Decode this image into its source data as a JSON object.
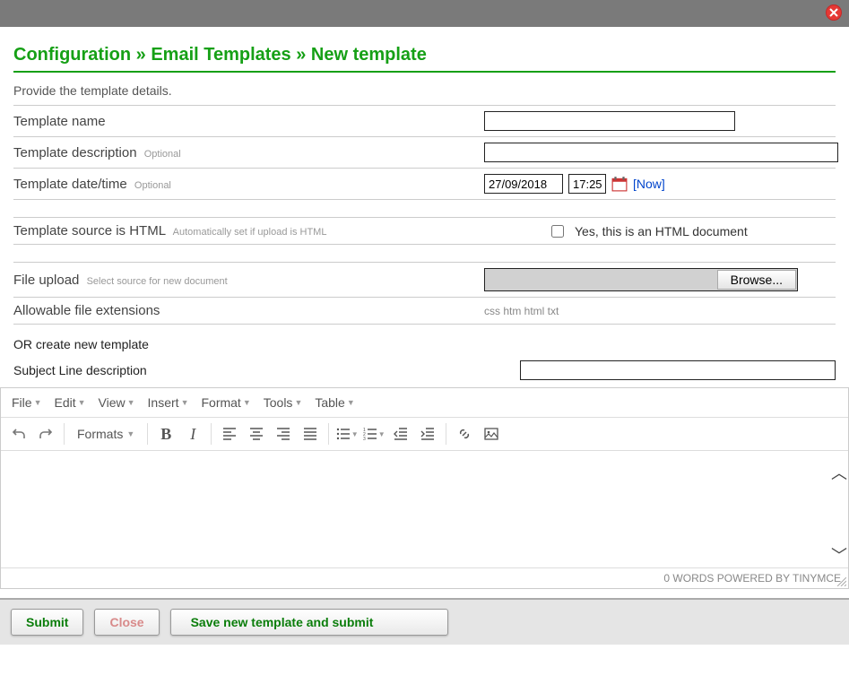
{
  "breadcrumb": "Configuration » Email Templates » New template",
  "instruction": "Provide the template details.",
  "fields": {
    "template_name": {
      "label": "Template name",
      "value": ""
    },
    "template_desc": {
      "label": "Template description",
      "hint": "Optional",
      "value": ""
    },
    "template_datetime": {
      "label": "Template date/time",
      "hint": "Optional",
      "date": "27/09/2018",
      "time": "17:25",
      "now": "[Now]"
    },
    "source_html": {
      "label": "Template source is HTML",
      "hint": "Automatically set if upload is HTML",
      "checkbox_label": "Yes, this is an HTML document",
      "checked": false
    },
    "file_upload": {
      "label": "File upload",
      "hint": "Select source for new document",
      "browse": "Browse..."
    },
    "extensions": {
      "label": "Allowable file extensions",
      "list": "css  htm  html  txt"
    }
  },
  "or_line": "OR create new template",
  "subject": {
    "label": "Subject Line description",
    "value": ""
  },
  "editor": {
    "menus": [
      "File",
      "Edit",
      "View",
      "Insert",
      "Format",
      "Tools",
      "Table"
    ],
    "formats_label": "Formats",
    "status": "0 WORDS POWERED BY TINYMCE"
  },
  "footer": {
    "submit": "Submit",
    "close": "Close",
    "hint": "Save new template and submit"
  }
}
